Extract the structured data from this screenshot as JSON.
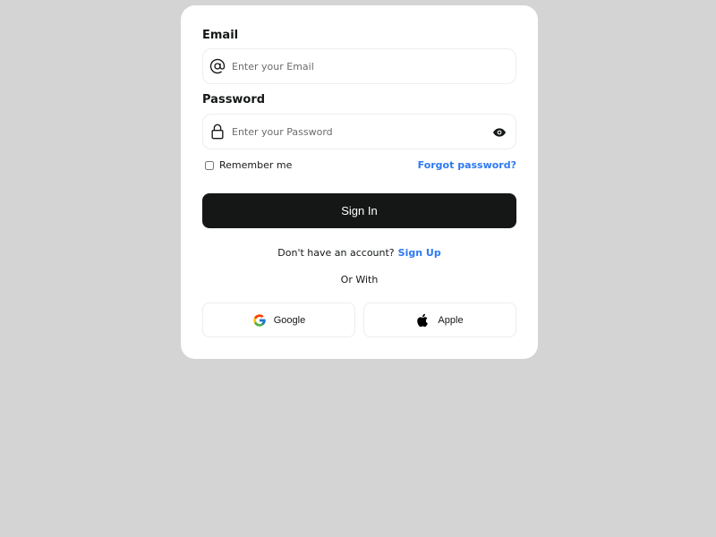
{
  "form": {
    "email_label": "Email",
    "email_placeholder": "Enter your Email",
    "email_value": "",
    "password_label": "Password",
    "password_placeholder": "Enter your Password",
    "password_value": "",
    "remember_label": "Remember me",
    "remember_checked": false,
    "forgot_label": "Forgot password?",
    "signin_label": "Sign In",
    "no_account_text": "Don't have an account?",
    "signup_label": "Sign Up",
    "or_with_text": "Or With",
    "google_label": "Google",
    "apple_label": "Apple"
  },
  "icons": {
    "email": "at-icon",
    "password": "lock-icon",
    "toggle_visibility": "eye-icon",
    "google": "google-icon",
    "apple": "apple-icon"
  },
  "colors": {
    "background": "#d4d4d4",
    "card": "#ffffff",
    "primary_button": "#151717",
    "link": "#2d79f3",
    "text": "#151717"
  }
}
